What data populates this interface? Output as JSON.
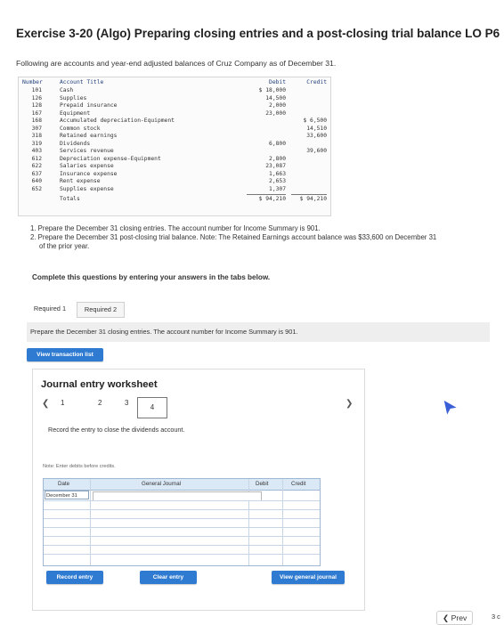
{
  "title": "Exercise 3-20 (Algo) Preparing closing entries and a post-closing trial balance LO P6",
  "intro": "Following are accounts and year-end adjusted balances of Cruz Company as of December 31.",
  "trial_balance": {
    "headers": {
      "number": "Number",
      "title": "Account Title",
      "debit": "Debit",
      "credit": "Credit"
    },
    "rows": [
      {
        "num": "101",
        "name": "Cash",
        "debit": "$ 18,000",
        "credit": ""
      },
      {
        "num": "126",
        "name": "Supplies",
        "debit": "14,500",
        "credit": ""
      },
      {
        "num": "128",
        "name": "Prepaid insurance",
        "debit": "2,000",
        "credit": ""
      },
      {
        "num": "167",
        "name": "Equipment",
        "debit": "23,000",
        "credit": ""
      },
      {
        "num": "168",
        "name": "Accumulated depreciation-Equipment",
        "debit": "",
        "credit": "$ 6,500"
      },
      {
        "num": "307",
        "name": "Common stock",
        "debit": "",
        "credit": "14,510"
      },
      {
        "num": "318",
        "name": "Retained earnings",
        "debit": "",
        "credit": "33,600"
      },
      {
        "num": "319",
        "name": "Dividends",
        "debit": "6,800",
        "credit": ""
      },
      {
        "num": "403",
        "name": "Services revenue",
        "debit": "",
        "credit": "39,600"
      },
      {
        "num": "612",
        "name": "Depreciation expense-Equipment",
        "debit": "2,800",
        "credit": ""
      },
      {
        "num": "622",
        "name": "Salaries expense",
        "debit": "23,087",
        "credit": ""
      },
      {
        "num": "637",
        "name": "Insurance expense",
        "debit": "1,663",
        "credit": ""
      },
      {
        "num": "640",
        "name": "Rent expense",
        "debit": "2,653",
        "credit": ""
      },
      {
        "num": "652",
        "name": "Supplies expense",
        "debit": "1,307",
        "credit": ""
      }
    ],
    "totals": {
      "label": "Totals",
      "debit": "$ 94,210",
      "credit": "$ 94,210"
    }
  },
  "instructions": [
    "1. Prepare the December 31 closing entries. The account number for Income Summary is 901.",
    "2. Prepare the December 31 post-closing trial balance. Note: The Retained Earnings account balance was $33,600 on December 31",
    "of the prior year."
  ],
  "complete_text": "Complete this questions by entering your answers in the tabs below.",
  "tabs": [
    "Required 1",
    "Required 2"
  ],
  "required_desc": "Prepare the December 31 closing entries. The account number for Income Summary is 901.",
  "view_transaction_list": "View transaction list",
  "worksheet": {
    "title": "Journal entry worksheet",
    "prev_icon": "chevron-left-icon",
    "next_icon": "chevron-right-icon",
    "pages": [
      "1",
      "2",
      "3",
      "4"
    ],
    "current_page": "4",
    "record_desc": "Record the entry to close the dividends account.",
    "note": "Note: Enter debits before credits.",
    "journal_headers": {
      "date": "Date",
      "general_journal": "General Journal",
      "debit": "Debit",
      "credit": "Credit"
    },
    "date_value": "December 31",
    "record_entry": "Record entry",
    "clear_entry": "Clear entry",
    "view_general_journal": "View general journal"
  },
  "footer": {
    "prev": "Prev",
    "page": "3 c"
  },
  "colors": {
    "accent": "#2f7bd1",
    "journal_header": "#dbe9f6"
  }
}
